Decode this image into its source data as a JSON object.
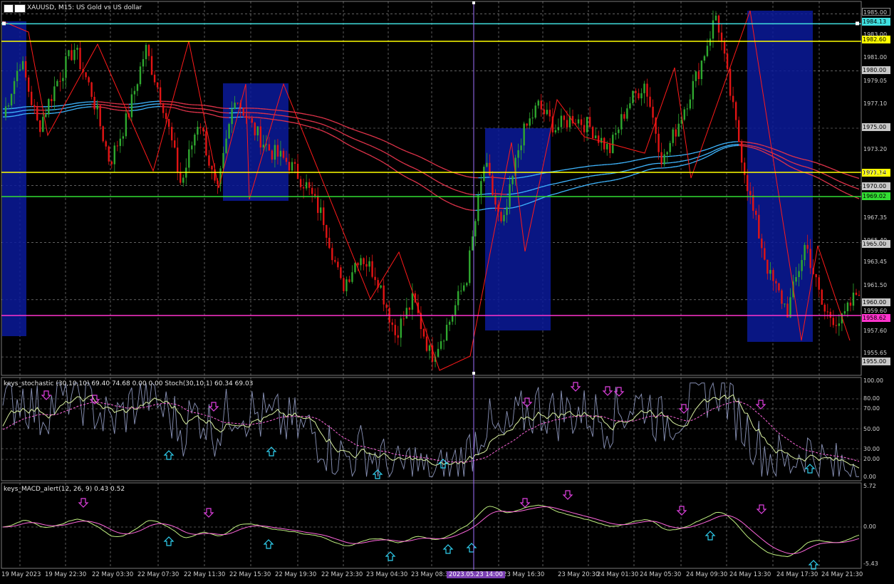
{
  "header": {
    "symbol": "XAUUSD",
    "timeframe": "M15",
    "description": "US Gold vs US dollar",
    "title": "XAUUSD, M15:  US Gold vs US dollar"
  },
  "price_axis": {
    "labels": [
      "1985.00",
      "1983.00",
      "1981.00",
      "1980.00",
      "1979.05",
      "1977.10",
      "1975.00",
      "1973.20",
      "1971.25",
      "1970.00",
      "1967.35",
      "1965.40",
      "1963.45",
      "1961.50",
      "1960.00",
      "1959.60",
      "1957.60",
      "1955.65",
      "1955.00"
    ],
    "tagged": [
      {
        "text": "1985.00",
        "color": "#c8c8c8",
        "bg": "#000000"
      },
      {
        "text": "1984.13",
        "color": "#000000",
        "bg": "#40e0e0"
      },
      {
        "text": "1982.60",
        "color": "#000000",
        "bg": "#ffff00"
      },
      {
        "text": "1980.00",
        "color": "#000000",
        "bg": "#c8c8c8"
      },
      {
        "text": "1975.00",
        "color": "#000000",
        "bg": "#c8c8c8"
      },
      {
        "text": "1971.14",
        "color": "#000000",
        "bg": "#ffff00"
      },
      {
        "text": "1970.00",
        "color": "#000000",
        "bg": "#c8c8c8"
      },
      {
        "text": "1969.02",
        "color": "#000000",
        "bg": "#33dd33"
      },
      {
        "text": "1965.00",
        "color": "#000000",
        "bg": "#c8c8c8"
      },
      {
        "text": "1960.00",
        "color": "#000000",
        "bg": "#c8c8c8"
      },
      {
        "text": "1958.62",
        "color": "#000000",
        "bg": "#ff33cc"
      },
      {
        "text": "1955.00",
        "color": "#000000",
        "bg": "#c8c8c8"
      }
    ]
  },
  "levels": [
    {
      "price": 1984.13,
      "color": "#40e0e0"
    },
    {
      "price": 1982.6,
      "color": "#ffff00"
    },
    {
      "price": 1971.14,
      "color": "#ffff00"
    },
    {
      "price": 1969.02,
      "color": "#33dd33"
    },
    {
      "price": 1958.62,
      "color": "#ff33cc"
    }
  ],
  "stochastic": {
    "title": "keys_stochastic (30,10,10) 69.40 74.68 0.00 0.00 Stoch(30,10,1) 60.34 69.03",
    "levels": [
      "100.00",
      "80.00",
      "70.00",
      "50.00",
      "30.00",
      "20.00",
      "0.00"
    ]
  },
  "macd": {
    "title": "keys_MACD_alert(12, 26, 9) 0.43 0.52",
    "levels": [
      "5.72",
      "0.00",
      "-5.43"
    ]
  },
  "time_axis": {
    "labels": [
      "19 May 2023",
      "19 May 22:30",
      "22 May 03:30",
      "22 May 07:30",
      "22 May 11:30",
      "22 May 15:30",
      "22 May 19:30",
      "22 May 23:30",
      "23 May 04:30",
      "23 May 08:30",
      "23 May 16:30",
      "23 May 20:30",
      "24 May 01:30",
      "24 May 05:30",
      "24 May 09:30",
      "24 May 13:30",
      "24 May 17:30",
      "24 May 21:30"
    ],
    "cursor": "2023.05.23 14:00"
  },
  "chart_data": {
    "type": "candlestick",
    "symbol": "XAUUSD",
    "timeframe": "M15",
    "ylim": [
      1954.0,
      1986.0
    ],
    "approx_close_path": [
      1976,
      1981,
      1975,
      1979,
      1982,
      1978,
      1972,
      1976,
      1982,
      1977,
      1970,
      1976,
      1969,
      1978,
      1975,
      1973,
      1972,
      1970,
      1967,
      1961,
      1964,
      1962,
      1957,
      1960,
      1955,
      1958,
      1962,
      1972,
      1966,
      1974,
      1977,
      1975,
      1976,
      1975,
      1973,
      1977,
      1979,
      1972,
      1976,
      1980,
      1985,
      1976,
      1968,
      1962,
      1959,
      1965,
      1959,
      1958,
      1961
    ]
  }
}
